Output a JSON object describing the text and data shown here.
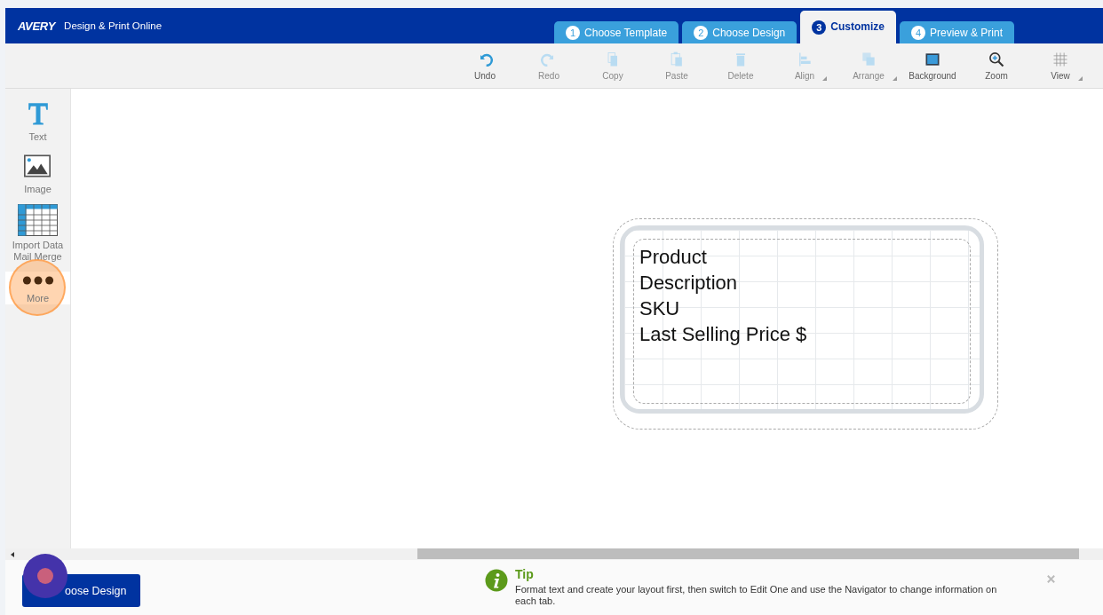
{
  "header": {
    "logo": "AVERY",
    "title": "Design & Print Online"
  },
  "tabs": [
    {
      "number": "1",
      "label": "Choose Template",
      "selected": false
    },
    {
      "number": "2",
      "label": "Choose Design",
      "selected": false
    },
    {
      "number": "3",
      "label": "Customize",
      "selected": true
    },
    {
      "number": "4",
      "label": "Preview & Print",
      "selected": false
    }
  ],
  "toolbar": [
    {
      "kind": "undo",
      "label": "Undo",
      "disabled": false,
      "has_menu": false
    },
    {
      "kind": "redo",
      "label": "Redo",
      "disabled": true,
      "has_menu": false
    },
    {
      "kind": "copy",
      "label": "Copy",
      "disabled": true,
      "has_menu": false
    },
    {
      "kind": "paste",
      "label": "Paste",
      "disabled": true,
      "has_menu": false
    },
    {
      "kind": "delete",
      "label": "Delete",
      "disabled": true,
      "has_menu": false
    },
    {
      "kind": "align",
      "label": "Align",
      "disabled": true,
      "has_menu": true
    },
    {
      "kind": "arrange",
      "label": "Arrange",
      "disabled": true,
      "has_menu": true
    },
    {
      "kind": "background",
      "label": "Background",
      "disabled": false,
      "has_menu": false
    },
    {
      "kind": "zoom",
      "label": "Zoom",
      "disabled": false,
      "has_menu": false
    },
    {
      "kind": "view",
      "label": "View",
      "disabled": false,
      "has_menu": true
    }
  ],
  "sidebar": [
    {
      "kind": "text",
      "lines": [
        "Text"
      ],
      "highlighted": false
    },
    {
      "kind": "image",
      "lines": [
        "Image"
      ],
      "highlighted": false
    },
    {
      "kind": "table",
      "lines": [
        "Import Data",
        "Mail Merge"
      ],
      "highlighted": false
    },
    {
      "kind": "more",
      "lines": [
        "More"
      ],
      "highlighted": true
    }
  ],
  "label": {
    "lines": [
      "Product",
      "Description",
      "SKU",
      "Last Selling Price $"
    ]
  },
  "bottom": {
    "button": "oose Design",
    "tip": {
      "title": "Tip",
      "text": "Format text and create your layout first, then switch to Edit One and use the Navigator to change information on each tab."
    }
  }
}
